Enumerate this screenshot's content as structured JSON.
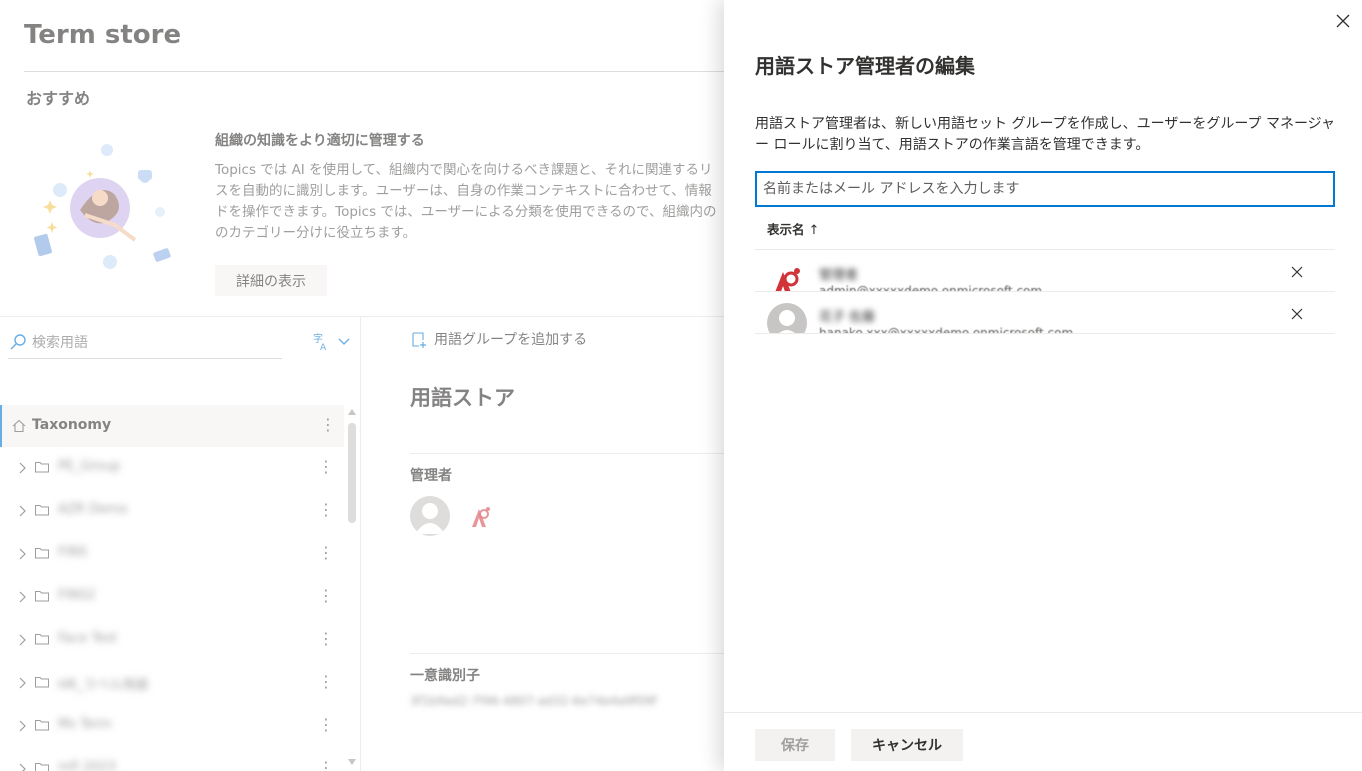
{
  "page": {
    "title": "Term store",
    "recommended_heading": "おすすめ",
    "recommendation": {
      "title": "組織の知識をより適切に管理する",
      "body_lines": [
        "Topics では AI を使用して、組織内で関心を向けるべき課題と、それに関連するリ",
        "スを自動的に識別します。ユーザーは、自身の作業コンテキストに合わせて、情報",
        "ドを操作できます。Topics では、ユーザーによる分類を使用できるので、組織内の",
        "のカテゴリー分けに役立ちます。"
      ],
      "details_button": "詳細の表示"
    }
  },
  "left_pane": {
    "search_placeholder": "検索用語",
    "search_icon": "search-icon",
    "language_icon": "translate-icon",
    "tree": {
      "root_label": "Taxonomy",
      "root_icon": "home-icon",
      "groups": [
        "PE_Group",
        "AZR Demo",
        "FINS",
        "FINS2",
        "Face Test",
        "HR_ラベル用語",
        "Ms Term",
        "mfl 2023"
      ]
    }
  },
  "right_pane": {
    "add_group_label": "用語グループを追加する",
    "store_title": "用語ストア",
    "admins_label": "管理者",
    "unique_id_label": "一意識別子",
    "unique_id_value": "3f1b9ad2-7f46-4807-ad32-6e74e4a9f09f"
  },
  "panel": {
    "title": "用語ストア管理者の編集",
    "description": "用語ストア管理者は、新しい用語セット グループを作成し、ユーザーをグループ マネージャー ロールに割り当て、用語ストアの作業言語を管理できます。",
    "input_placeholder": "名前またはメール アドレスを入力します",
    "column_header": "表示名",
    "sort_arrow": "↑",
    "admins": [
      {
        "name": "管理者",
        "email": "admin@xxxxxdemo.onmicrosoft.com",
        "avatar": "company-logo-icon"
      },
      {
        "name": "花子 佐藤",
        "email": "hanako.xxx@xxxxxdemo.onmicrosoft.com",
        "avatar": "person-avatar-icon"
      }
    ],
    "save_label": "保存",
    "cancel_label": "キャンセル"
  },
  "colors": {
    "accent": "#0078d4",
    "logo_red": "#d13438",
    "text": "#323130",
    "subtext": "#605e5c"
  }
}
